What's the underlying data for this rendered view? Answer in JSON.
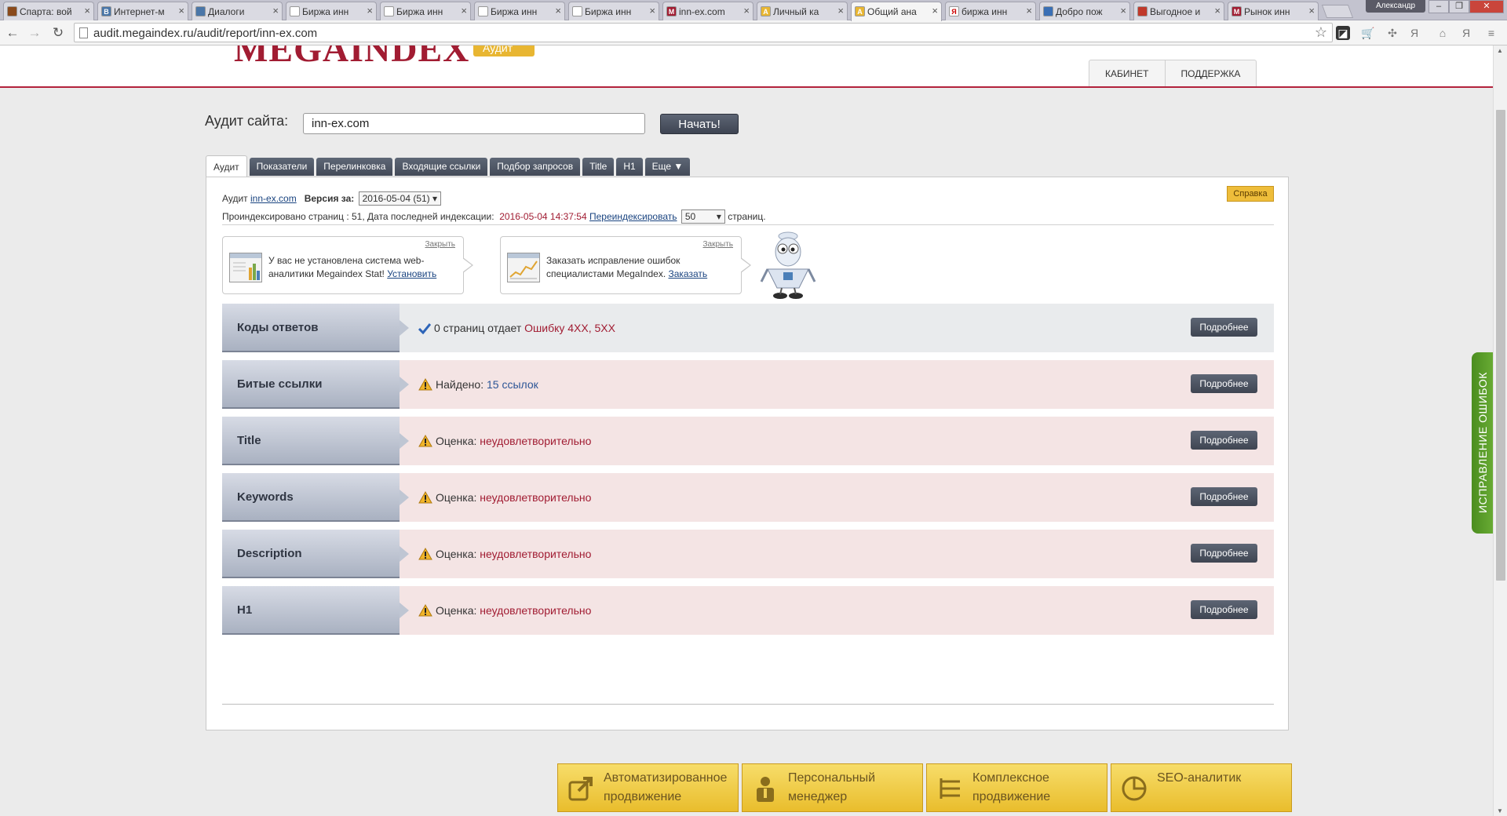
{
  "browser": {
    "tabs": [
      {
        "title": "Спарта: вой",
        "favicon_color": "#8a4a1c",
        "favicon_glyph": "",
        "active": false
      },
      {
        "title": "Интернет-м",
        "favicon_color": "#4a76a8",
        "favicon_glyph": "В",
        "active": false
      },
      {
        "title": "Диалоги",
        "favicon_color": "#4a76a8",
        "favicon_glyph": "",
        "active": false
      },
      {
        "title": "Биржа инн",
        "favicon_color": "#ffffff",
        "favicon_glyph": "",
        "active": false
      },
      {
        "title": "Биржа инн",
        "favicon_color": "#ffffff",
        "favicon_glyph": "",
        "active": false
      },
      {
        "title": "Биржа инн",
        "favicon_color": "#ffffff",
        "favicon_glyph": "",
        "active": false
      },
      {
        "title": "Биржа инн",
        "favicon_color": "#ffffff",
        "favicon_glyph": "",
        "active": false
      },
      {
        "title": "inn-ex.com",
        "favicon_color": "#a11c32",
        "favicon_glyph": "M",
        "active": false
      },
      {
        "title": "Личный ка",
        "favicon_color": "#e8b632",
        "favicon_glyph": "A",
        "active": false
      },
      {
        "title": "Общий ана",
        "favicon_color": "#e8b632",
        "favicon_glyph": "A",
        "active": true
      },
      {
        "title": "биржа инн",
        "favicon_color": "#ffffff",
        "favicon_glyph": "Я",
        "active": false
      },
      {
        "title": "Добро пож",
        "favicon_color": "#3a6fb5",
        "favicon_glyph": "",
        "active": false
      },
      {
        "title": "Выгодное и",
        "favicon_color": "#c0392b",
        "favicon_glyph": "",
        "active": false
      },
      {
        "title": "Рынок инн",
        "favicon_color": "#a11c32",
        "favicon_glyph": "M",
        "active": false
      }
    ],
    "profile_name": "Александр",
    "url": "audit.megaindex.ru/audit/report/inn-ex.com"
  },
  "site": {
    "logo_text": "MEGAINDEX",
    "logo_badge": "Аудит",
    "nav": [
      "КАБИНЕТ",
      "ПОДДЕРЖКА"
    ]
  },
  "audit_form": {
    "label": "Аудит сайта:",
    "input_value": "inn-ex.com",
    "start_button": "Начать!"
  },
  "report_tabs": [
    "Аудит",
    "Показатели",
    "Перелинковка",
    "Входящие ссылки",
    "Подбор запросов",
    "Title",
    "H1",
    "Еще ▼"
  ],
  "report": {
    "audit_prefix": "Аудит",
    "domain_link": "inn-ex.com",
    "version_label": "Версия за:",
    "version_value": "2016-05-04 (51) ▾",
    "help_button": "Справка",
    "indexed_text": "Проиндексировано страниц : 51, Дата последней индексации:",
    "index_date": "2016-05-04 14:37:54",
    "reindex_link": "Переиндексировать",
    "pages_value": "50",
    "pages_suffix": "страниц."
  },
  "promos": [
    {
      "close": "Закрыть",
      "text": "У вас не установлена система web-аналитики Megaindex Stat!",
      "link": "Установить"
    },
    {
      "close": "Закрыть",
      "text": "Заказать исправление ошибок специалистами MegaIndex.",
      "link": "Заказать"
    }
  ],
  "checks": [
    {
      "label": "Коды ответов",
      "status": "ok",
      "prefix": "0 страниц отдает",
      "highlight": "Ошибку 4XX, 5XX",
      "more": "Подробнее"
    },
    {
      "label": "Битые ссылки",
      "status": "warning",
      "prefix": "Найдено:",
      "highlight": "15 ссылок",
      "more": "Подробнее"
    },
    {
      "label": "Title",
      "status": "warning",
      "prefix": "Оценка:",
      "highlight": "неудовлетворительно",
      "more": "Подробнее"
    },
    {
      "label": "Keywords",
      "status": "warning",
      "prefix": "Оценка:",
      "highlight": "неудовлетворительно",
      "more": "Подробнее"
    },
    {
      "label": "Description",
      "status": "warning",
      "prefix": "Оценка:",
      "highlight": "неудовлетворительно",
      "more": "Подробнее"
    },
    {
      "label": "H1",
      "status": "warning",
      "prefix": "Оценка:",
      "highlight": "неудовлетворительно",
      "more": "Подробнее"
    }
  ],
  "side_tab": "ИСПРАВЛЕНИЕ ОШИБОК",
  "features": [
    {
      "label": "Автоматизированное продвижение",
      "icon": "external-link-icon"
    },
    {
      "label": "Персональный менеджер",
      "icon": "person-icon"
    },
    {
      "label": "Комплексное продвижение",
      "icon": "hierarchy-icon"
    },
    {
      "label": "SEO-аналитик",
      "icon": "pie-chart-icon"
    }
  ],
  "colors": {
    "brand": "#a11c32",
    "accent_yellow": "#e8b632",
    "ok_row": "#e9ebed",
    "error_row": "#f4e4e4",
    "side_tab_green": "#5a9e2a"
  }
}
